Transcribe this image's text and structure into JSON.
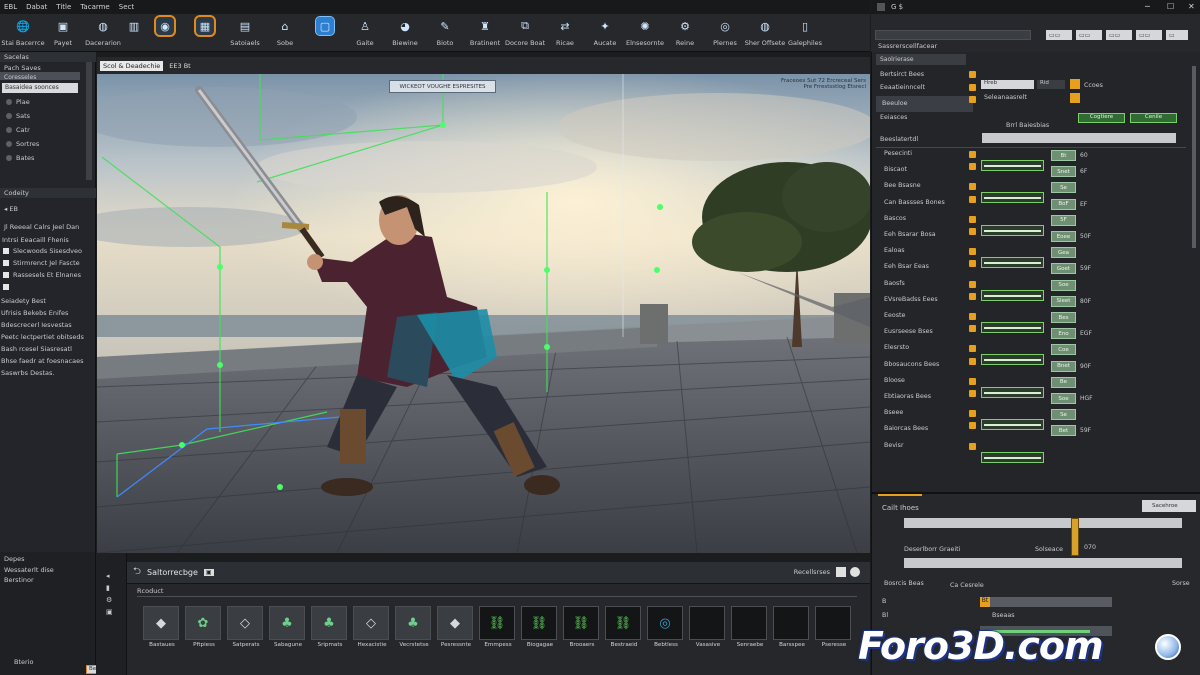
{
  "menu": [
    "EBL",
    "Dabat",
    "Title",
    "Tacarme",
    "Sect"
  ],
  "toolbar": [
    {
      "label": "Stai Bacerrce",
      "icon": "globe-icon"
    },
    {
      "label": "Payet",
      "icon": "cube-icon"
    },
    {
      "label": "Dacerarion",
      "icon": "sphere-icon"
    },
    {
      "label": "",
      "icon": "trash-icon"
    },
    {
      "label": "",
      "icon": "camera-icon"
    },
    {
      "label": "",
      "icon": "transform-icon"
    },
    {
      "label": "Satoiaels",
      "icon": "grid-icon"
    },
    {
      "label": "Sobe",
      "icon": "home-icon"
    },
    {
      "label": "",
      "icon": "viewport-icon"
    },
    {
      "label": "Gaite",
      "icon": "person-icon"
    },
    {
      "label": "Biewine",
      "icon": "globe-blue-icon"
    },
    {
      "label": "Bioto",
      "icon": "brush-icon"
    },
    {
      "label": "Bratinent",
      "icon": "figure-icon"
    },
    {
      "label": "Docore Boat",
      "icon": "nodes-icon"
    },
    {
      "label": "Ricae",
      "icon": "arrows-icon"
    },
    {
      "label": "Aucate",
      "icon": "light-icon"
    },
    {
      "label": "Elnsesornte",
      "icon": "fx-icon"
    },
    {
      "label": "Reine",
      "icon": "gear-icon"
    },
    {
      "label": "Plernes",
      "icon": "orb-icon"
    },
    {
      "label": "Sher Offsete",
      "icon": "sphere-icon"
    },
    {
      "label": "Galephiles",
      "icon": "cup-icon"
    }
  ],
  "right_title": "G $",
  "left_panel": {
    "title": "Sacelas",
    "sub1": "Pach Saves",
    "sub2": "Coresseles",
    "filter": "Basaidea soonces",
    "tree": [
      "Plae",
      "Sats",
      "Catr",
      "Sortres",
      "Bates"
    ],
    "section2_title": "Codeity",
    "section2_input": "EB",
    "section2_note": "Jl Reeeal Calrs Jeel Dan",
    "section2_head": "Intrsi Eeacaill Fhenis",
    "checks": [
      "Slecwoods Sisesdveo",
      "Stirmrenct Jel Fascte",
      "Rassesels Et Elnanes",
      ""
    ],
    "notes": [
      "Seiadety Best",
      "Ufrisis Bekebs Enifes",
      "Bdescrecerl Iesvestas",
      "Peetc lectpertiet obitseds",
      "Bash rcesel Siasresatl",
      "Bhse faedr at foesnacaes",
      "Saswrbs Destas."
    ],
    "lower_head": "Depes",
    "lower_items": [
      "Wessaterlt dise",
      "Berstinor"
    ],
    "lower_foot": "Bterio",
    "lower_foot_right": "Becus"
  },
  "viewport": {
    "tag": "Scol & Deadechie",
    "right_tag": "EE3 Bt",
    "overlay": "WICKEOT VOUGHE ESPRESITES",
    "info_line1": "Fraceoes Sut 72 Ercreceal Sers",
    "info_line2": "Pre Frrestsstlog Etsrecl"
  },
  "content_browser": {
    "title": "Saltorrecbge",
    "search": "Recellsrses",
    "breadcrumb": "Rcoduct",
    "assets": [
      {
        "label": "Bastaues",
        "icon": "rock-icon"
      },
      {
        "label": "Pftpiess",
        "icon": "foliage-icon"
      },
      {
        "label": "Satperats",
        "icon": "crystal-icon"
      },
      {
        "label": "Sabagune",
        "icon": "plant-icon"
      },
      {
        "label": "Sripmats",
        "icon": "plant-icon"
      },
      {
        "label": "Hexacistie",
        "icon": "crystal-icon"
      },
      {
        "label": "Vecrstetse",
        "icon": "plant-icon"
      },
      {
        "label": "Pesressnte",
        "icon": "rock-icon"
      },
      {
        "label": "Emmpess",
        "icon": "link-icon"
      },
      {
        "label": "Biogagae",
        "icon": "link-icon"
      },
      {
        "label": "Brooaers",
        "icon": "link-icon"
      },
      {
        "label": "Bestraeid",
        "icon": "link-icon"
      },
      {
        "label": "Bebtless",
        "icon": "orb-icon"
      },
      {
        "label": "Vasasive",
        "icon": ""
      },
      {
        "label": "Senraebe",
        "icon": ""
      },
      {
        "label": "Barsspee",
        "icon": ""
      },
      {
        "label": "Pseresse",
        "icon": ""
      }
    ]
  },
  "right_panel": {
    "header": "Sassrerscellfacear",
    "tab": "Saolrierase",
    "row1": "Bertsirct Bees",
    "row2": "Eeaatieinncelt",
    "row3": "Beeuloe",
    "row4": "Eeiasces",
    "row5": "Eleiadorostmat",
    "row6": "Beeslatertdl",
    "field_a": "Hreb",
    "field_b": "Rid",
    "tag1": "Ccoes",
    "tag2": "Seleanaasrelt",
    "mid_label": "Brrl Baiesbias",
    "btn1": "Cogtiere",
    "btn2": "Cenile",
    "props": [
      {
        "label": "Pesecinti",
        "val": "Bt",
        "unit": "60"
      },
      {
        "label": "Biscaot",
        "val": "Snet",
        "unit": "6F"
      },
      {
        "label": "Bee Bsasne",
        "val": "Se",
        "unit": ""
      },
      {
        "label": "Can Bassses Bones",
        "val": "BoF",
        "unit": "EF"
      },
      {
        "label": "Bascos",
        "val": "5F",
        "unit": ""
      },
      {
        "label": "Eeh Bsarar Bosa",
        "val": "Eoee",
        "unit": "50F"
      },
      {
        "label": "Ealoas",
        "val": "Gea",
        "unit": ""
      },
      {
        "label": "Eeh Bsar Eeas",
        "val": "Goet",
        "unit": "59F"
      },
      {
        "label": "Baosfs",
        "val": "Soe",
        "unit": ""
      },
      {
        "label": "EVsreBadss Eees",
        "val": "Sleet",
        "unit": "80F"
      },
      {
        "label": "Eeoste",
        "val": "Bes",
        "unit": ""
      },
      {
        "label": "Eusrseese Bses",
        "val": "Eno",
        "unit": "EGF"
      },
      {
        "label": "Elesrsto",
        "val": "Coe",
        "unit": ""
      },
      {
        "label": "Bbosaucons Bees",
        "val": "Bnet",
        "unit": "90F"
      },
      {
        "label": "Bloose",
        "val": "Be",
        "unit": ""
      },
      {
        "label": "Ebtiaoras Bees",
        "val": "Soe",
        "unit": "HGF"
      },
      {
        "label": "Bseee",
        "val": "Se",
        "unit": ""
      },
      {
        "label": "Baiorcas Bees",
        "val": "Bet",
        "unit": "59F"
      },
      {
        "label": "Bevisr",
        "val": "",
        "unit": ""
      }
    ]
  },
  "right_lower": {
    "title": "Cailt Ihoes",
    "btn": "Sacehroe",
    "row1_label": "Deserlborr Graeiti",
    "row1_mid": "Solseace",
    "row1_val": "070",
    "row2_label": "Bosrcis Beas",
    "row2_mid": "Ca Cesrele",
    "row2_val": "Sorse",
    "k1": "B",
    "k2": "Bl",
    "k3": "Bseaas",
    "k4": "Bsa",
    "k5": "Bt"
  },
  "watermark": "Foro3D.com"
}
